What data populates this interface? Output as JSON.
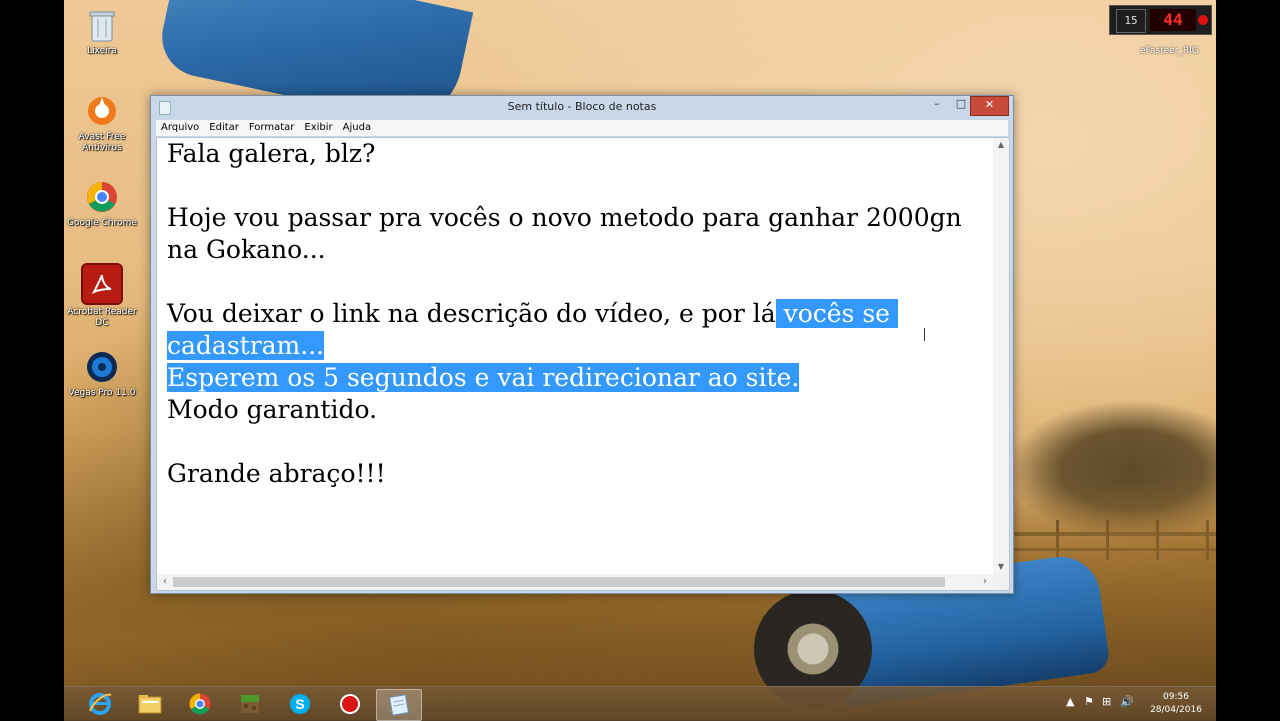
{
  "desktop": {
    "icons": [
      {
        "label": "Lixeira"
      },
      {
        "label": "Avast Free Antivirus"
      },
      {
        "label": "Google Chrome"
      },
      {
        "label": "Acrobat Reader DC"
      },
      {
        "label": "Vegas Pro 11.0"
      }
    ],
    "overlay": {
      "box1": "15",
      "fps": "44",
      "name": "eFasteer_RIG"
    }
  },
  "notepad": {
    "title": "Sem título - Bloco de notas",
    "menu": [
      "Arquivo",
      "Editar",
      "Formatar",
      "Exibir",
      "Ajuda"
    ],
    "lines": {
      "l1": "Fala galera, blz?",
      "l2": "Hoje vou passar pra vocês o novo metodo para ganhar 2000gn na Gokano...",
      "l3_plain": "Vou deixar o link na descrição do vídeo, e por lá",
      "l3_sel": " vocês se cadastram...",
      "l4_sel": "Esperem os 5 segundos e vai redirecionar ao site.",
      "l5": "Modo garantido.",
      "l6": "Grande abraço!!!"
    },
    "controls": {
      "minimize": "–",
      "maximize": "□",
      "close": "✕"
    }
  },
  "taskbar": {
    "apps": [
      "internet-explorer",
      "file-explorer",
      "google-chrome",
      "minecraft",
      "skype",
      "recorder",
      "notepad"
    ],
    "clock": {
      "time": "09:56",
      "date": "28/04/2016"
    },
    "tray": {
      "up": "▲",
      "flag": "⚑",
      "network": "⊞",
      "volume": "🔊"
    }
  },
  "colors": {
    "selection": "#3399ff",
    "close": "#c74a3a"
  }
}
